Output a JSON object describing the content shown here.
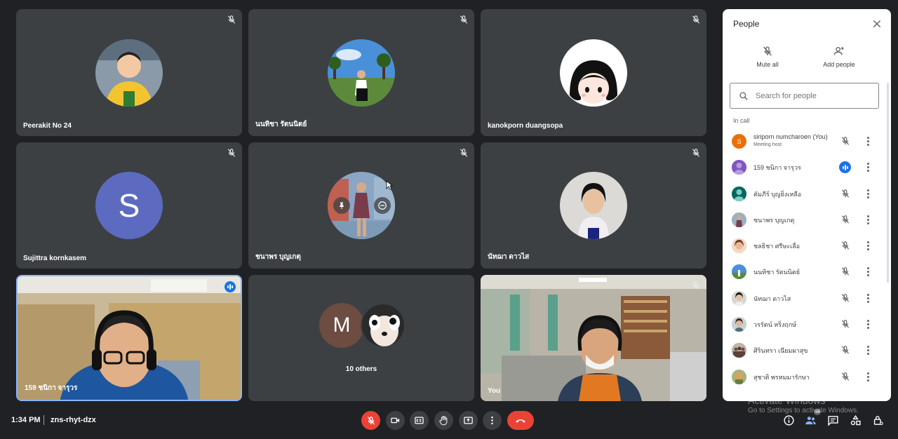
{
  "participants": [
    {
      "name": "Peerakit No 24"
    },
    {
      "name": "นนทิชา รัตนนิตย์"
    },
    {
      "name": "kanokporn duangsopa"
    },
    {
      "name": "Sujittra kornkasem",
      "initial": "S"
    },
    {
      "name": "ชนาพร บุญเกตุ"
    },
    {
      "name": "นัทฌา ดาวไส"
    },
    {
      "name": "159 ชนิกา จารุวร"
    },
    {
      "name": "You"
    }
  ],
  "others_tile": {
    "initial": "M",
    "label": "10 others"
  },
  "people_panel": {
    "title": "People",
    "mute_all": "Mute all",
    "add_people": "Add people",
    "search_placeholder": "Search for people",
    "section": "In call",
    "people": [
      {
        "name": "siriporn numcharoen (You)",
        "sub": "Meeting host",
        "initial": "S",
        "color": "#e8710a"
      },
      {
        "name": "159 ชนิกา จารุวร",
        "speaking": true,
        "color": "#7e57c2"
      },
      {
        "name": "คัมภีร์ บุญยิ่งเหลือ",
        "color": "#00695c"
      },
      {
        "name": "ชนาพร บุญเกตุ",
        "color": "#8d8d8d"
      },
      {
        "name": "ชลธิชา ศรีษะเลื่อ",
        "color": "#c48b6b"
      },
      {
        "name": "นนทิชา รัตนนิตย์",
        "color": "#6b8fb5"
      },
      {
        "name": "นัทฌา ดาวไส",
        "color": "#9e9e9e"
      },
      {
        "name": "วรรัตน์ หริ่งฤกษ์",
        "color": "#a1887f"
      },
      {
        "name": "ศิรินทรา เนียมผาสุข",
        "color": "#795548"
      },
      {
        "name": "สุชาติ พรหมมารักษา",
        "color": "#8d9e6b"
      }
    ]
  },
  "bottom_bar": {
    "time": "1:34 PM",
    "meeting_code": "zns-rhyt-dzx",
    "people_count": "18"
  },
  "watermark": {
    "line1": "Activate Windows",
    "line2": "Go to Settings to activate Windows."
  },
  "colors": {
    "accent": "#1a73e8",
    "danger": "#ea4335",
    "tile": "#3c4043",
    "background": "#202124"
  }
}
